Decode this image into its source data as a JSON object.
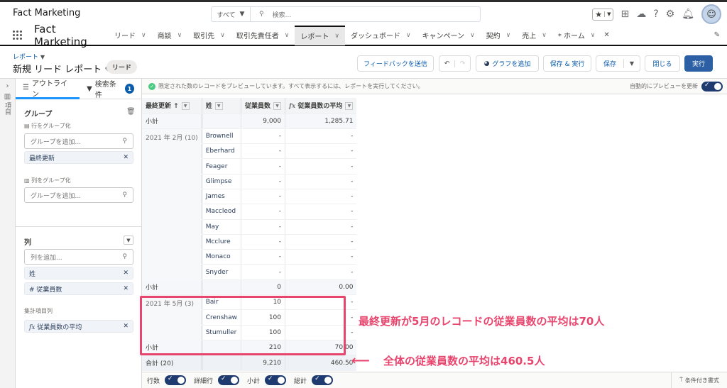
{
  "header": {
    "brand": "Fact Marketing",
    "search_scope": "すべて",
    "search_placeholder": "検索..."
  },
  "nav": {
    "app_name": "Fact Marketing",
    "tabs": [
      {
        "label": "リード"
      },
      {
        "label": "商談"
      },
      {
        "label": "取引先"
      },
      {
        "label": "取引先責任者"
      },
      {
        "label": "レポート",
        "active": true
      },
      {
        "label": "ダッシュボード"
      },
      {
        "label": "キャンペーン"
      },
      {
        "label": "契約"
      },
      {
        "label": "売上"
      },
      {
        "label": "* ホーム"
      }
    ]
  },
  "page": {
    "breadcrumb": "レポート",
    "title": "新規 リード レポート",
    "type_badge": "リード"
  },
  "toolbar": {
    "feedback": "フィードバックを送信",
    "add_chart": "グラフを追加",
    "save_run": "保存 & 実行",
    "save": "保存",
    "close": "閉じる",
    "run": "実行"
  },
  "left": {
    "side_label": "項目",
    "tab_outline": "アウトライン",
    "tab_filters": "検索条件",
    "filter_count": "1",
    "group_heading": "グループ",
    "group_rows": "行をグループ化",
    "group_rows_placeholder": "グループを追加...",
    "group_rows_chip": "最終更新",
    "group_cols": "列をグループ化",
    "group_cols_placeholder": "グループを追加...",
    "columns_heading": "列",
    "columns_placeholder": "列を追加...",
    "columns": [
      "姓",
      "# 従業員数"
    ],
    "summary_heading": "集計項目列",
    "summary_chip": "従業員数の平均"
  },
  "status": {
    "message": "限定された数のレコードをプレビューしています。すべて表示するには、レポートを実行してください。",
    "auto_preview": "自動的にプレビューを更新"
  },
  "table": {
    "headers": [
      "最終更新 ↑",
      "姓",
      "従業員数",
      "従業員数の平均"
    ],
    "top_subtotal": {
      "label": "小計",
      "count": "9,000",
      "avg": "1,285.71"
    },
    "groups": [
      {
        "label": "2021 年 2月 (10)",
        "rows": [
          [
            "Brownell",
            "-",
            "-"
          ],
          [
            "Eberhard",
            "-",
            "-"
          ],
          [
            "Feager",
            "-",
            "-"
          ],
          [
            "Glimpse",
            "-",
            "-"
          ],
          [
            "James",
            "-",
            "-"
          ],
          [
            "Maccleod",
            "-",
            "-"
          ],
          [
            "May",
            "-",
            "-"
          ],
          [
            "Mcclure",
            "-",
            "-"
          ],
          [
            "Monaco",
            "-",
            "-"
          ],
          [
            "Snyder",
            "-",
            "-"
          ]
        ],
        "subtotal": {
          "label": "小計",
          "count": "0",
          "avg": "0.00"
        }
      },
      {
        "label": "2021 年 5月 (3)",
        "rows": [
          [
            "Bair",
            "10",
            "-"
          ],
          [
            "Crenshaw",
            "100",
            "-"
          ],
          [
            "Stumuller",
            "100",
            "-"
          ]
        ],
        "subtotal": {
          "label": "小計",
          "count": "210",
          "avg": "70.00"
        }
      }
    ],
    "total": {
      "label": "合計 (20)",
      "count": "9,210",
      "avg": "460.50"
    }
  },
  "annotations": {
    "note1": "最終更新が5月のレコードの従業員数の平均は70人",
    "note2": "全体の従業員数の平均は460.5人",
    "color": "#e8456e"
  },
  "footer": {
    "row_counts": "行数",
    "detail_rows": "詳細行",
    "subtotals": "小計",
    "grand_total": "総計",
    "conditional_format": "条件付き書式"
  }
}
